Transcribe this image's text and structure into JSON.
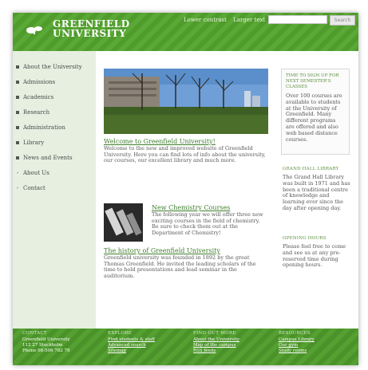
{
  "header": {
    "brand_line1": "GREENFIELD",
    "brand_line2": "UNIVERSITY",
    "lower_contrast": "Lower contrast",
    "larger_text": "Larger text",
    "search_placeholder": "",
    "search_button": "Search"
  },
  "sidebar": {
    "items": [
      {
        "label": "About the University",
        "marker": "square"
      },
      {
        "label": "Admissions",
        "marker": "square"
      },
      {
        "label": "Academics",
        "marker": "square"
      },
      {
        "label": "Research",
        "marker": "square"
      },
      {
        "label": "Administration",
        "marker": "square"
      },
      {
        "label": "Library",
        "marker": "square"
      },
      {
        "label": "News and Events",
        "marker": "square"
      },
      {
        "label": "About Us",
        "marker": "dash"
      },
      {
        "label": "Contact",
        "marker": "dash"
      }
    ]
  },
  "main": {
    "welcome": {
      "title": "Welcome to Greenfield University!",
      "body": "Welcome to the new and improved website of Greenfield University. Here you can find lots of info about the university, our courses, our excellent library and much more."
    },
    "chemistry": {
      "title": "New Chemistry Courses",
      "body": "The following year we will offer three new exciting courses in the field of chemistry. Be sure to check them out at the Department of Chemistry!"
    },
    "history": {
      "title": "The history of Greenfield University",
      "body": "Greenfield university was founded in 1892 by the great Thomas Greenfield. He invited the leading scholars of the time to hold presentations and lead seminar in the auditorium."
    }
  },
  "right": {
    "notice_title": "TIME TO SIGN UP FOR NEXT SEMESTER'S CLASSES",
    "notice_body": "Over 100 courses are available to students at the University of Greenfield. Many different programs are offered and also web based distance courses.",
    "library_heading": "GRAND HALL LIBRARY",
    "library_body": "The Grand Hall Library was built in 1971 and has been a traditional centre of knowledge and learning ever since the day after opening day.",
    "hours_heading": "OPENING HOURS",
    "hours_body": "Please feel free to come and see us at any pre-reserved time during opening hours."
  },
  "footer": {
    "contact_heading": "CONTACT",
    "contact_line1": "Greenfield University",
    "contact_line2": "112 27 Stockholm",
    "contact_line3": "Phone 08-506 782 78",
    "explore_heading": "EXPLORE",
    "explore_links": [
      "Find students & staff",
      "Advanced search",
      "Sitemap"
    ],
    "findout_heading": "FIND OUT MORE",
    "findout_links": [
      "About the University",
      "Map of the campus",
      "RSS feeds"
    ],
    "resources_heading": "RESOURCES",
    "resources_links": [
      "Campus Library",
      "Our gym",
      "Study rooms"
    ]
  },
  "colors": {
    "brand_green": "#4f9b2c",
    "sidebar_bg": "#e6efe0",
    "link_green": "#3f7f2d"
  }
}
